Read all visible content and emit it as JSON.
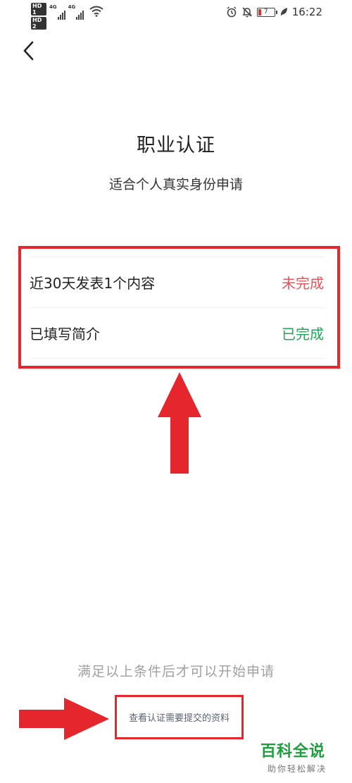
{
  "status_bar": {
    "hd1": "HD 1",
    "hd2": "HD 2",
    "net1": "4G",
    "net2": "4G",
    "battery": "7",
    "time": "16:22"
  },
  "header": {
    "title": "职业认证",
    "subtitle": "适合个人真实身份申请"
  },
  "conditions": [
    {
      "label": "近30天发表1个内容",
      "status": "未完成",
      "status_color": "#e0565b"
    },
    {
      "label": "已填写简介",
      "status": "已完成",
      "status_color": "#23a35a"
    }
  ],
  "footer": {
    "notice": "满足以上条件后才可以开始申请",
    "link": "查看认证需要提交的资料"
  },
  "watermark": {
    "title": "百科全说",
    "subtitle": "助你轻松解决"
  },
  "colors": {
    "annotation_red": "#e5262d",
    "incomplete": "#e0565b",
    "complete": "#23a35a"
  }
}
